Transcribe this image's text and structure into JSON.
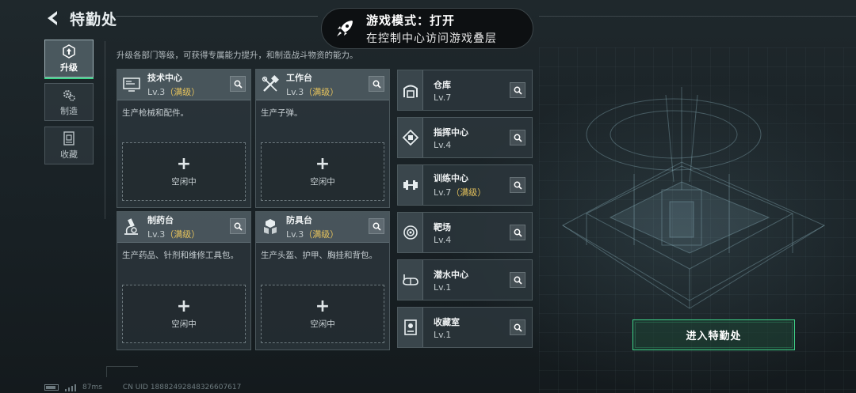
{
  "header": {
    "title": "特勤处"
  },
  "toast": {
    "title": "游戏模式：打开",
    "subtitle": "在控制中心访问游戏叠层"
  },
  "sidebar": {
    "items": [
      {
        "label": "升级",
        "icon": "upgrade-icon",
        "active": true
      },
      {
        "label": "制造",
        "icon": "gears-icon",
        "active": false
      },
      {
        "label": "收藏",
        "icon": "collection-icon",
        "active": false
      }
    ]
  },
  "description": "升级各部门等级，可获得专属能力提升，和制造战斗物资的能力。",
  "cards": [
    {
      "name": "技术中心",
      "level": "Lv.3",
      "max": "（满级）",
      "desc": "生产枪械和配件。",
      "slot_label": "空闲中",
      "icon": "tech-center-icon"
    },
    {
      "name": "工作台",
      "level": "Lv.3",
      "max": "（满级）",
      "desc": "生产子弹。",
      "slot_label": "空闲中",
      "icon": "workbench-icon"
    },
    {
      "name": "制药台",
      "level": "Lv.3",
      "max": "（满级）",
      "desc": "生产药品、针剂和维修工具包。",
      "slot_label": "空闲中",
      "icon": "microscope-icon"
    },
    {
      "name": "防具台",
      "level": "Lv.3",
      "max": "（满级）",
      "desc": "生产头盔、护甲、胸挂和背包。",
      "slot_label": "空闲中",
      "icon": "armor-icon"
    }
  ],
  "facilities": [
    {
      "name": "仓库",
      "level": "Lv.7",
      "max": "",
      "icon": "warehouse-icon"
    },
    {
      "name": "指挥中心",
      "level": "Lv.4",
      "max": "",
      "icon": "chip-icon"
    },
    {
      "name": "训练中心",
      "level": "Lv.7",
      "max": "（满级）",
      "icon": "dumbbell-icon"
    },
    {
      "name": "靶场",
      "level": "Lv.4",
      "max": "",
      "icon": "target-icon"
    },
    {
      "name": "潜水中心",
      "level": "Lv.1",
      "max": "",
      "icon": "goggles-icon"
    },
    {
      "name": "收藏室",
      "level": "Lv.1",
      "max": "",
      "icon": "trophy-icon"
    }
  ],
  "enter_button": "进入特勤处",
  "footer": {
    "ping": "87ms",
    "uid": "CN UID 18882492848326607617"
  },
  "colors": {
    "accent": "#3fd48a",
    "max_level": "#e6c35c"
  }
}
